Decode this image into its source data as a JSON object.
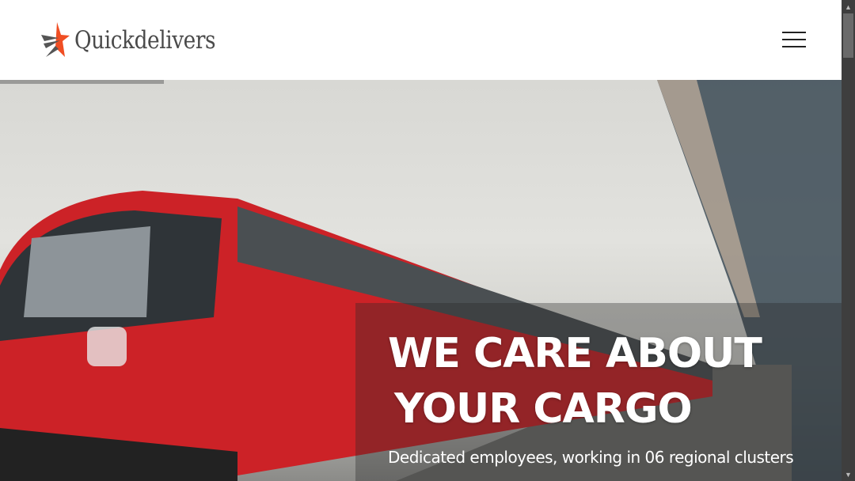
{
  "header": {
    "logo_text": "Quickdelivers",
    "menu_icon": "hamburger-icon"
  },
  "hero": {
    "title_line1": "WE CARE ABOUT",
    "title_line2": "YOUR CARGO",
    "subtitle": "Dedicated employees, working in 06 regional clusters"
  },
  "colors": {
    "logo_star_orange": "#f04e23",
    "logo_star_gray": "#555555",
    "train_red": "#d9262b"
  }
}
